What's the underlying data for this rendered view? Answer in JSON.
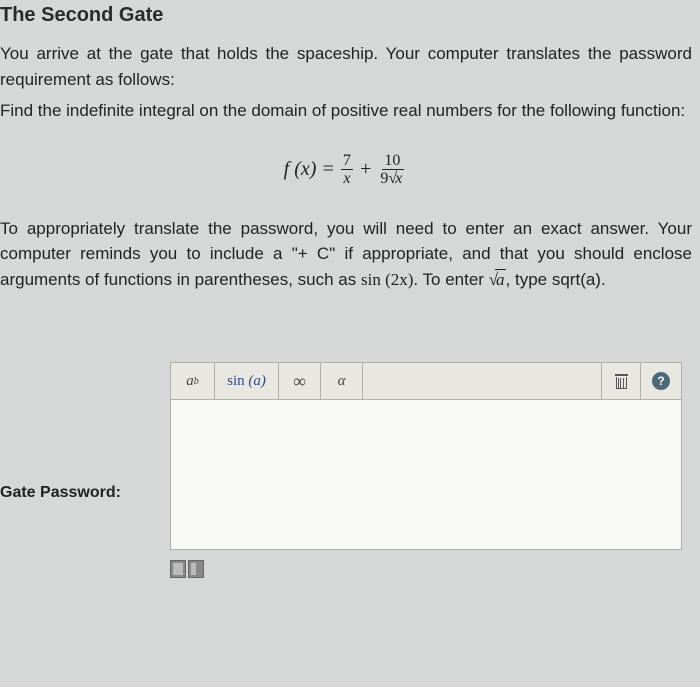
{
  "title": "The Second Gate",
  "intro": "You arrive at the gate that holds the spaceship. Your computer translates the password requirement as follows:",
  "intro_bold": "Find the indefinite integral on the domain of positive real numbers for the following function:",
  "formula": {
    "lhs": "f (x) =",
    "frac1_num": "7",
    "frac1_den": "x",
    "plus": "+",
    "frac2_num": "10",
    "frac2_den_coef": "9",
    "frac2_den_rad": "x"
  },
  "instructions": {
    "line": "To appropriately translate the password, you will need to enter an exact answer. Your computer reminds you to include a \"+ C\" if appropriate, and that you should enclose arguments of functions in parentheses, such as ",
    "sin_example": "sin (2x)",
    "middle": ". To enter ",
    "sqrt_a": "a",
    "tail": ", type sqrt(a)."
  },
  "label": "Gate Password:",
  "toolbar": {
    "exp_base": "a",
    "exp_sup": "b",
    "sin_label": "sin",
    "sin_arg": "(a)",
    "infinity": "∞",
    "alpha": "α",
    "help": "?"
  }
}
